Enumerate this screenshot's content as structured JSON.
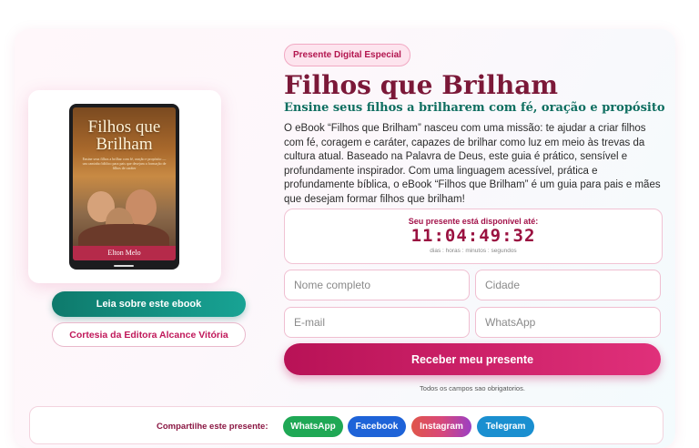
{
  "hero": {
    "badge": "Presente Digital Especial",
    "title": "Filhos que Brilham",
    "subtitle": "Ensine seus filhos a brilharem com fé, oração e propósito",
    "description": "O eBook “Filhos que Brilham” nasceu com uma missão: te ajudar a criar filhos com fé, coragem e caráter, capazes de brilhar como luz em meio às trevas da cultura atual. Baseado na Palavra de Deus, este guia é prático, sensível e profundamente inspirador. Com uma linguagem acessível, prática e profundamente bíblica, o eBook “Filhos que Brilham” é um guia para pais e mães que desejam formar filhos que brilham!"
  },
  "book": {
    "cover_title_line1": "Filhos que",
    "cover_title_line2": "Brilham",
    "cover_subtitle": "Ensine seus filhos a brilhar com fé, oração e propósito — um caminho bíblico para pais que desejam a formação de filhos de caráter",
    "author": "Elton Melo",
    "read_button": "Leia sobre este ebook",
    "courtesy_button": "Cortesia da Editora Alcance Vitória"
  },
  "countdown": {
    "label": "Seu presente está disponível até:",
    "time": "11:04:49:32",
    "units": "dias : horas : minutos : segundos"
  },
  "form": {
    "name_placeholder": "Nome completo",
    "city_placeholder": "Cidade",
    "email_placeholder": "E-mail",
    "whatsapp_placeholder": "WhatsApp",
    "submit": "Receber meu presente",
    "required_note": "Todos os campos sao obrigatorios."
  },
  "share": {
    "label": "Compartilhe este presente:",
    "buttons": [
      {
        "label": "WhatsApp",
        "color": "#1fa855"
      },
      {
        "label": "Facebook",
        "color": "#1e63d8"
      },
      {
        "label": "Instagram",
        "color": "#d8487a"
      },
      {
        "label": "Telegram",
        "color": "#1a8fd0"
      }
    ]
  }
}
